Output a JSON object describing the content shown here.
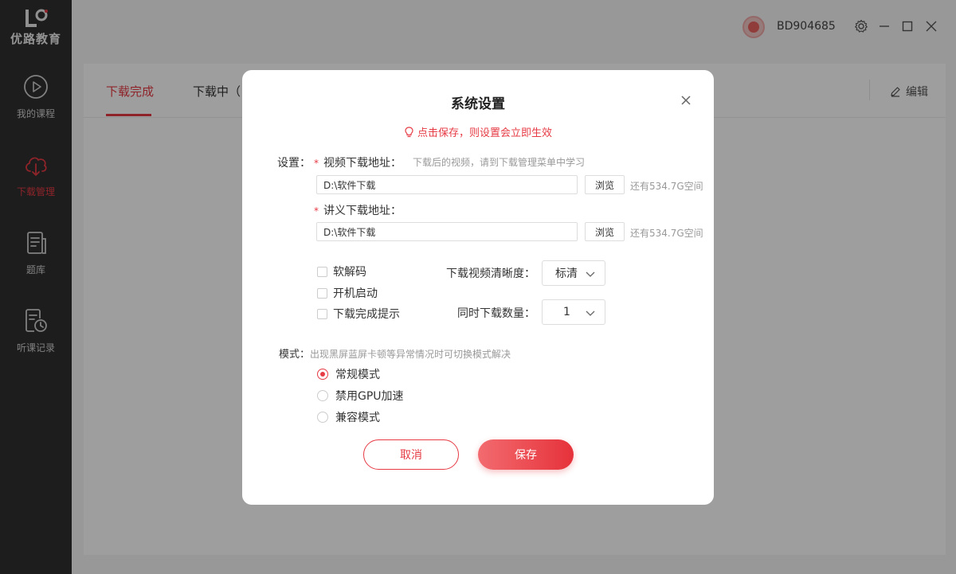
{
  "app": {
    "logo_text": "优路教育",
    "username": "BD904685"
  },
  "sidebar": {
    "items": [
      {
        "label": "我的课程",
        "icon": "play-circle-icon"
      },
      {
        "label": "下载管理",
        "icon": "cloud-download-icon",
        "active": true
      },
      {
        "label": "题库",
        "icon": "question-bank-icon"
      },
      {
        "label": "听课记录",
        "icon": "history-icon"
      }
    ]
  },
  "main": {
    "tabs": [
      {
        "label": "下载完成",
        "active": true
      },
      {
        "label": "下载中（"
      }
    ],
    "edit_label": "编辑"
  },
  "dialog": {
    "title": "系统设置",
    "hint": "点击保存，则设置会立即生效",
    "settings_label": "设置：",
    "video_path": {
      "required_mark": "*",
      "label": "视频下载地址：",
      "tip": "下载后的视频，请到下载管理菜单中学习",
      "value": "D:\\软件下载",
      "browse": "浏览",
      "space": "还有534.7G空间"
    },
    "handout_path": {
      "required_mark": "*",
      "label": "讲义下载地址：",
      "value": "D:\\软件下载",
      "browse": "浏览",
      "space": "还有534.7G空间"
    },
    "checkboxes": [
      {
        "label": "软解码",
        "checked": false
      },
      {
        "label": "开机启动",
        "checked": false
      },
      {
        "label": "下载完成提示",
        "checked": false
      }
    ],
    "quality": {
      "label": "下载视频清晰度：",
      "value": "标清"
    },
    "concurrency": {
      "label": "同时下载数量：",
      "value": "1"
    },
    "mode": {
      "label": "模式：",
      "tip": "出现黑屏蓝屏卡顿等异常情况时可切换模式解决",
      "options": [
        {
          "label": "常规模式",
          "checked": true
        },
        {
          "label": "禁用GPU加速",
          "checked": false
        },
        {
          "label": "兼容模式",
          "checked": false
        }
      ]
    },
    "cancel": "取消",
    "save": "保存"
  },
  "colors": {
    "accent": "#e63b44",
    "sidebar_bg": "#2f2f2f"
  }
}
